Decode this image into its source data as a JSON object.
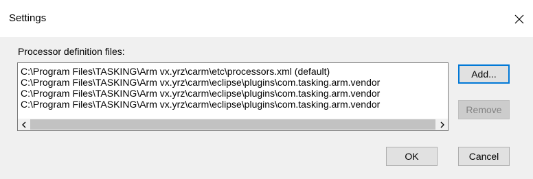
{
  "dialog": {
    "title": "Settings"
  },
  "group": {
    "label": "Processor definition files:"
  },
  "files": [
    "C:\\Program Files\\TASKING\\Arm vx.yrz\\carm\\etc\\processors.xml (default)",
    "C:\\Program Files\\TASKING\\Arm vx.yrz\\carm\\eclipse\\plugins\\com.tasking.arm.vendor",
    "C:\\Program Files\\TASKING\\Arm vx.yrz\\carm\\eclipse\\plugins\\com.tasking.arm.vendor",
    "C:\\Program Files\\TASKING\\Arm vx.yrz\\carm\\eclipse\\plugins\\com.tasking.arm.vendor"
  ],
  "buttons": {
    "add": "Add...",
    "remove": "Remove",
    "ok": "OK",
    "cancel": "Cancel"
  },
  "icons": {
    "close": "close-icon",
    "scroll_left": "chevron-left-icon",
    "scroll_right": "chevron-right-icon"
  }
}
